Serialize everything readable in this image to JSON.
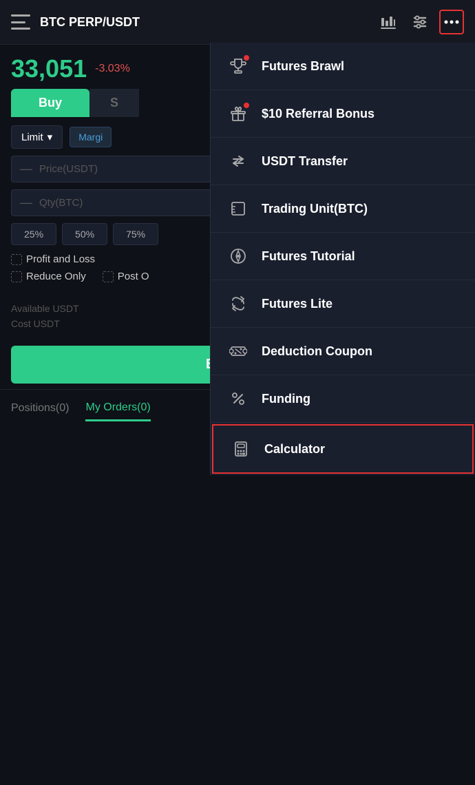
{
  "header": {
    "title": "BTC PERP/USDT",
    "menu_label": "menu",
    "chart_icon": "chart-icon",
    "settings_icon": "settings-icon",
    "more_icon": "more-icon"
  },
  "price": {
    "value": "33,051",
    "change": "-3.03%"
  },
  "trade": {
    "buy_label": "Buy",
    "sell_label": "S",
    "order_type": "Limit",
    "margin_label": "Margi",
    "price_placeholder": "Price(USDT)",
    "qty_placeholder": "Qty(BTC)",
    "pct_buttons": [
      "25%",
      "50%",
      "75%"
    ],
    "profit_loss_label": "Profit and Loss",
    "reduce_only_label": "Reduce Only",
    "post_only_label": "Post O",
    "available_label": "Available USDT",
    "cost_label": "Cost USDT",
    "buy_long_label": "Buy/Long"
  },
  "bottom_tabs": {
    "positions_label": "Positions(0)",
    "my_orders_label": "My Orders(0)"
  },
  "dropdown": {
    "items": [
      {
        "id": "futures-brawl",
        "label": "Futures Brawl",
        "icon": "trophy",
        "has_dot": true,
        "highlighted": false
      },
      {
        "id": "referral-bonus",
        "label": "$10 Referral Bonus",
        "icon": "gift",
        "has_dot": true,
        "highlighted": false
      },
      {
        "id": "usdt-transfer",
        "label": "USDT Transfer",
        "icon": "transfer",
        "has_dot": false,
        "highlighted": false
      },
      {
        "id": "trading-unit",
        "label": "Trading Unit(BTC)",
        "icon": "ruler",
        "has_dot": false,
        "highlighted": false
      },
      {
        "id": "futures-tutorial",
        "label": "Futures Tutorial",
        "icon": "compass",
        "has_dot": false,
        "highlighted": false
      },
      {
        "id": "futures-lite",
        "label": "Futures Lite",
        "icon": "swap",
        "has_dot": false,
        "highlighted": false
      },
      {
        "id": "deduction-coupon",
        "label": "Deduction Coupon",
        "icon": "coupon",
        "has_dot": false,
        "highlighted": false
      },
      {
        "id": "funding",
        "label": "Funding",
        "icon": "percent",
        "has_dot": false,
        "highlighted": false
      },
      {
        "id": "calculator",
        "label": "Calculator",
        "icon": "calculator",
        "has_dot": false,
        "highlighted": true
      }
    ]
  }
}
